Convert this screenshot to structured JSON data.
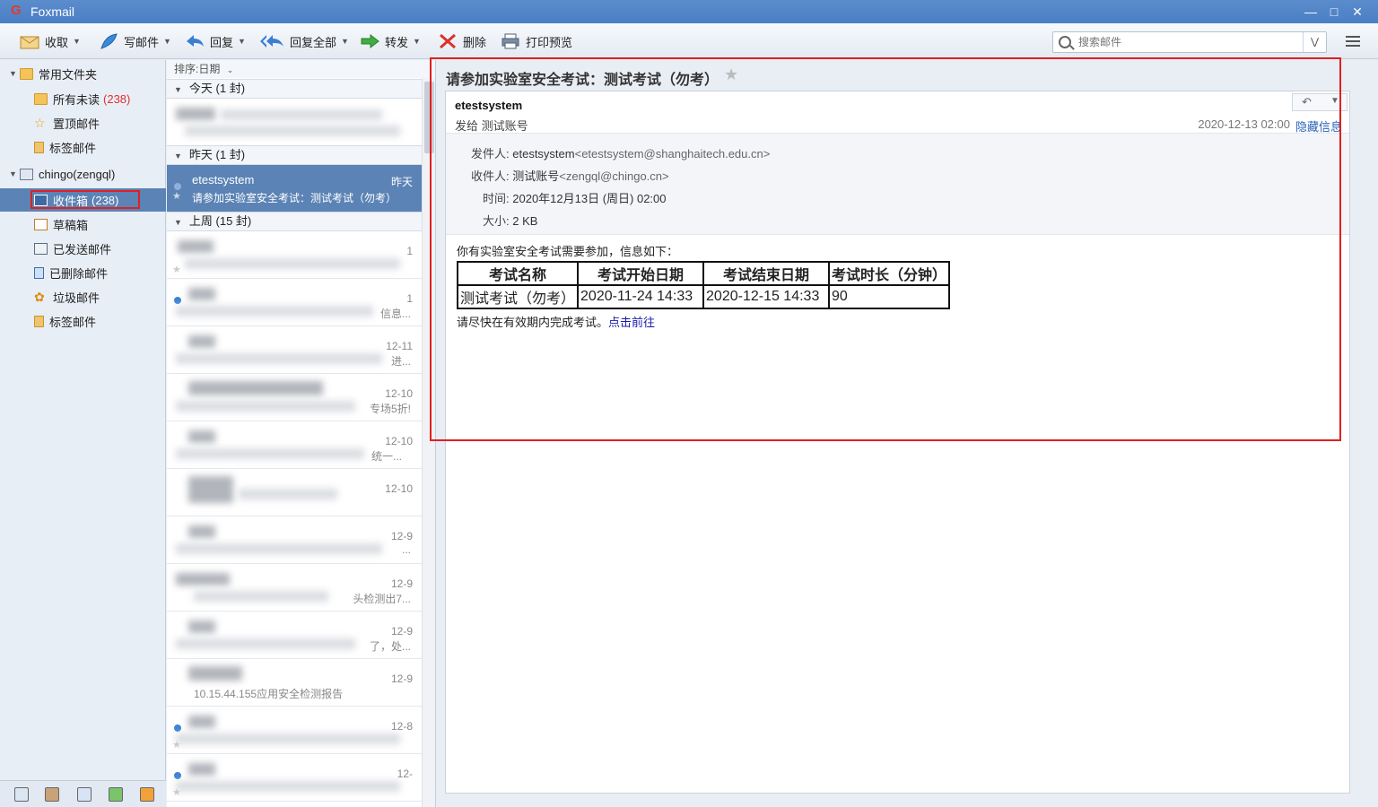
{
  "window": {
    "title": "Foxmail"
  },
  "toolbar": {
    "receive": "收取",
    "compose": "写邮件",
    "reply": "回复",
    "reply_all": "回复全部",
    "forward": "转发",
    "delete": "删除",
    "print_preview": "打印预览",
    "search_placeholder": "搜索邮件"
  },
  "folders": {
    "common_group": "常用文件夹",
    "all_unread": "所有未读",
    "all_unread_count": "(238)",
    "pinned": "置顶邮件",
    "tagged": "标签邮件",
    "account": "chingo(zengql)",
    "inbox": "收件箱",
    "inbox_count": "(238)",
    "drafts": "草稿箱",
    "sent": "已发送邮件",
    "deleted": "已删除邮件",
    "junk": "垃圾邮件",
    "account_tagged": "标签邮件"
  },
  "maillist": {
    "sort_label": "排序:日期",
    "group_today": "今天 (1 封)",
    "group_yesterday": "昨天 (1 封)",
    "group_lastweek": "上周 (15 封)",
    "selected_from": "etestsystem",
    "selected_date": "昨天",
    "selected_subject": "请参加实验室安全考试：测试考试（勿考）",
    "dates": [
      "1",
      "1",
      "12-11",
      "12-10",
      "12-10",
      "12-10",
      "12-9",
      "12-9",
      "12-9",
      "12-9",
      "12-8",
      "12-"
    ],
    "snippets": [
      "信息...",
      "进...",
      "专场5折!",
      "统一...",
      "",
      "",
      "...",
      "头检测出7...",
      "了，处...",
      "10.15.44.155应用安全检测报告",
      "",
      ""
    ]
  },
  "reader": {
    "subject": "请参加实验室安全考试：测试考试（勿考）",
    "sender_name": "etestsystem",
    "sent_to": "发给 测试账号",
    "date": "2020-12-13 02:00",
    "hide_info": "隐藏信息",
    "from_label": "发件人:",
    "from_name": "etestsystem",
    "from_addr": "<etestsystem@shanghaitech.edu.cn>",
    "to_label": "收件人:",
    "to_name": "测试账号",
    "to_addr": "<zengql@chingo.cn>",
    "time_label": "时间:",
    "time_value": "2020年12月13日 (周日) 02:00",
    "size_label": "大小:",
    "size_value": "2 KB",
    "intro": "你有实验室安全考试需要参加，信息如下：",
    "table_headers": [
      "考试名称",
      "考试开始日期",
      "考试结束日期",
      "考试时长（分钟）"
    ],
    "table_row": [
      "测试考试（勿考）",
      "2020-11-24 14:33",
      "2020-12-15 14:33",
      "90"
    ],
    "finish_text": "请尽快在有效期内完成考试。",
    "link_text": "点击前往"
  },
  "colors": {
    "accent": "#5b83b5",
    "highlight": "#e02020",
    "unread": "#e03030",
    "link": "#1a1aa8"
  }
}
